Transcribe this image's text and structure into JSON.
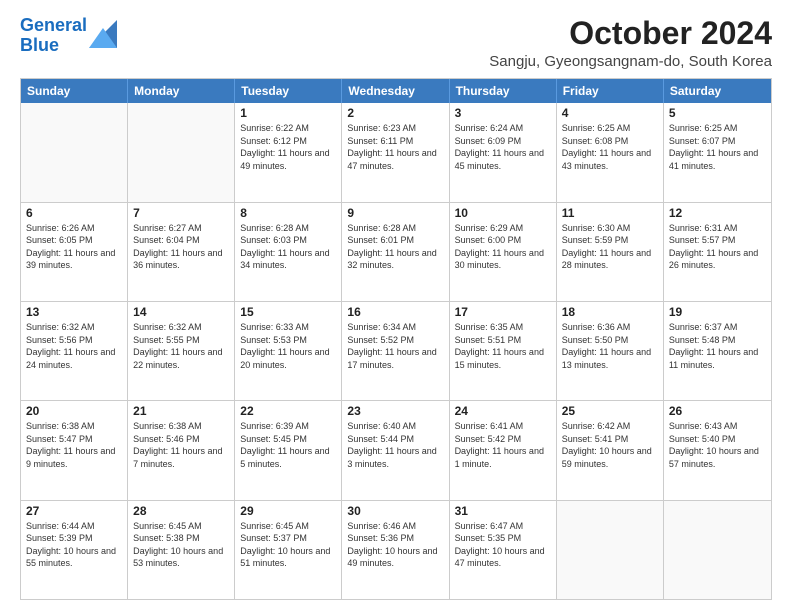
{
  "logo": {
    "line1": "General",
    "line2": "Blue"
  },
  "title": "October 2024",
  "subtitle": "Sangju, Gyeongsangnam-do, South Korea",
  "days_of_week": [
    "Sunday",
    "Monday",
    "Tuesday",
    "Wednesday",
    "Thursday",
    "Friday",
    "Saturday"
  ],
  "weeks": [
    [
      {
        "day": "",
        "info": ""
      },
      {
        "day": "",
        "info": ""
      },
      {
        "day": "1",
        "info": "Sunrise: 6:22 AM\nSunset: 6:12 PM\nDaylight: 11 hours and 49 minutes."
      },
      {
        "day": "2",
        "info": "Sunrise: 6:23 AM\nSunset: 6:11 PM\nDaylight: 11 hours and 47 minutes."
      },
      {
        "day": "3",
        "info": "Sunrise: 6:24 AM\nSunset: 6:09 PM\nDaylight: 11 hours and 45 minutes."
      },
      {
        "day": "4",
        "info": "Sunrise: 6:25 AM\nSunset: 6:08 PM\nDaylight: 11 hours and 43 minutes."
      },
      {
        "day": "5",
        "info": "Sunrise: 6:25 AM\nSunset: 6:07 PM\nDaylight: 11 hours and 41 minutes."
      }
    ],
    [
      {
        "day": "6",
        "info": "Sunrise: 6:26 AM\nSunset: 6:05 PM\nDaylight: 11 hours and 39 minutes."
      },
      {
        "day": "7",
        "info": "Sunrise: 6:27 AM\nSunset: 6:04 PM\nDaylight: 11 hours and 36 minutes."
      },
      {
        "day": "8",
        "info": "Sunrise: 6:28 AM\nSunset: 6:03 PM\nDaylight: 11 hours and 34 minutes."
      },
      {
        "day": "9",
        "info": "Sunrise: 6:28 AM\nSunset: 6:01 PM\nDaylight: 11 hours and 32 minutes."
      },
      {
        "day": "10",
        "info": "Sunrise: 6:29 AM\nSunset: 6:00 PM\nDaylight: 11 hours and 30 minutes."
      },
      {
        "day": "11",
        "info": "Sunrise: 6:30 AM\nSunset: 5:59 PM\nDaylight: 11 hours and 28 minutes."
      },
      {
        "day": "12",
        "info": "Sunrise: 6:31 AM\nSunset: 5:57 PM\nDaylight: 11 hours and 26 minutes."
      }
    ],
    [
      {
        "day": "13",
        "info": "Sunrise: 6:32 AM\nSunset: 5:56 PM\nDaylight: 11 hours and 24 minutes."
      },
      {
        "day": "14",
        "info": "Sunrise: 6:32 AM\nSunset: 5:55 PM\nDaylight: 11 hours and 22 minutes."
      },
      {
        "day": "15",
        "info": "Sunrise: 6:33 AM\nSunset: 5:53 PM\nDaylight: 11 hours and 20 minutes."
      },
      {
        "day": "16",
        "info": "Sunrise: 6:34 AM\nSunset: 5:52 PM\nDaylight: 11 hours and 17 minutes."
      },
      {
        "day": "17",
        "info": "Sunrise: 6:35 AM\nSunset: 5:51 PM\nDaylight: 11 hours and 15 minutes."
      },
      {
        "day": "18",
        "info": "Sunrise: 6:36 AM\nSunset: 5:50 PM\nDaylight: 11 hours and 13 minutes."
      },
      {
        "day": "19",
        "info": "Sunrise: 6:37 AM\nSunset: 5:48 PM\nDaylight: 11 hours and 11 minutes."
      }
    ],
    [
      {
        "day": "20",
        "info": "Sunrise: 6:38 AM\nSunset: 5:47 PM\nDaylight: 11 hours and 9 minutes."
      },
      {
        "day": "21",
        "info": "Sunrise: 6:38 AM\nSunset: 5:46 PM\nDaylight: 11 hours and 7 minutes."
      },
      {
        "day": "22",
        "info": "Sunrise: 6:39 AM\nSunset: 5:45 PM\nDaylight: 11 hours and 5 minutes."
      },
      {
        "day": "23",
        "info": "Sunrise: 6:40 AM\nSunset: 5:44 PM\nDaylight: 11 hours and 3 minutes."
      },
      {
        "day": "24",
        "info": "Sunrise: 6:41 AM\nSunset: 5:42 PM\nDaylight: 11 hours and 1 minute."
      },
      {
        "day": "25",
        "info": "Sunrise: 6:42 AM\nSunset: 5:41 PM\nDaylight: 10 hours and 59 minutes."
      },
      {
        "day": "26",
        "info": "Sunrise: 6:43 AM\nSunset: 5:40 PM\nDaylight: 10 hours and 57 minutes."
      }
    ],
    [
      {
        "day": "27",
        "info": "Sunrise: 6:44 AM\nSunset: 5:39 PM\nDaylight: 10 hours and 55 minutes."
      },
      {
        "day": "28",
        "info": "Sunrise: 6:45 AM\nSunset: 5:38 PM\nDaylight: 10 hours and 53 minutes."
      },
      {
        "day": "29",
        "info": "Sunrise: 6:45 AM\nSunset: 5:37 PM\nDaylight: 10 hours and 51 minutes."
      },
      {
        "day": "30",
        "info": "Sunrise: 6:46 AM\nSunset: 5:36 PM\nDaylight: 10 hours and 49 minutes."
      },
      {
        "day": "31",
        "info": "Sunrise: 6:47 AM\nSunset: 5:35 PM\nDaylight: 10 hours and 47 minutes."
      },
      {
        "day": "",
        "info": ""
      },
      {
        "day": "",
        "info": ""
      }
    ]
  ]
}
